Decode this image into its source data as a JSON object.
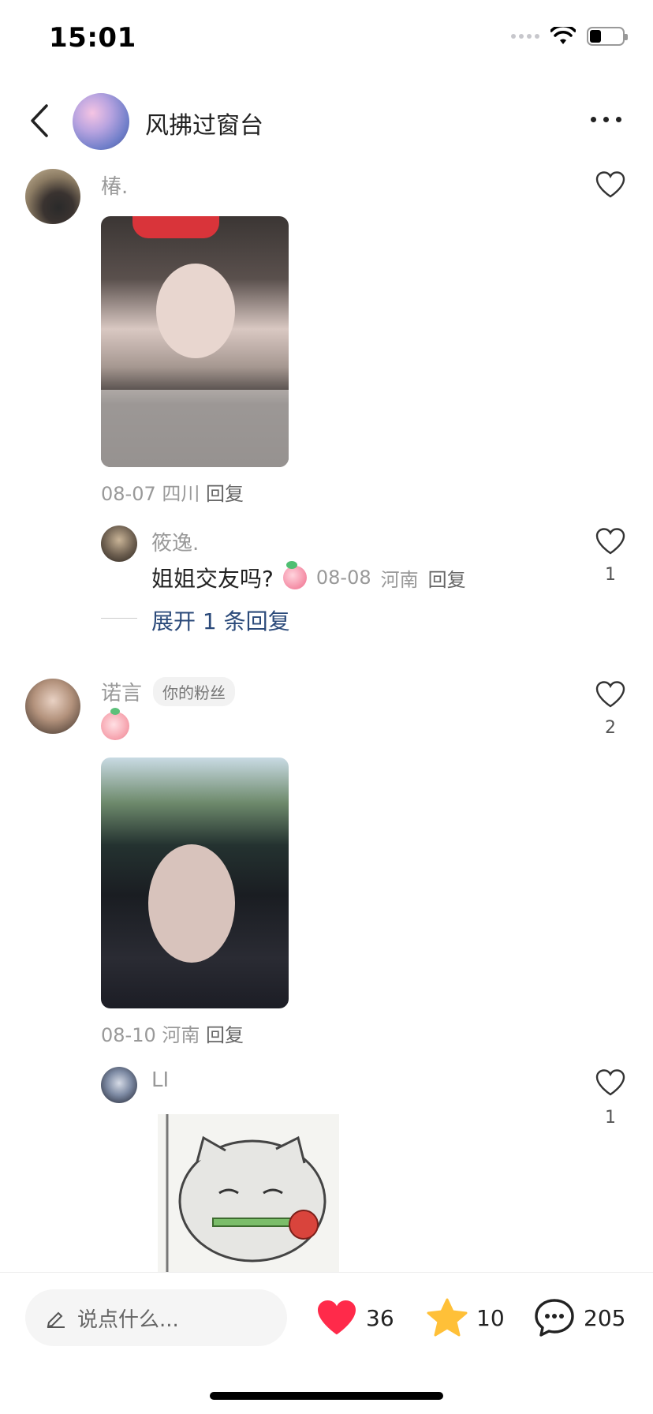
{
  "status_bar": {
    "time": "15:01"
  },
  "header": {
    "title": "风拂过窗台"
  },
  "comments": [
    {
      "name": "椿.",
      "meta_date": "08-07",
      "meta_location": "四川",
      "reply_label": "回复",
      "replies": [
        {
          "name": "筱逸.",
          "text": "姐姐交友吗?",
          "meta_date": "08-08",
          "meta_location": "河南",
          "reply_label": "回复",
          "likes": "1"
        }
      ],
      "expand_label": "展开 1 条回复"
    },
    {
      "name": "诺言",
      "badge": "你的粉丝",
      "likes": "2",
      "meta_date": "08-10",
      "meta_location": "河南",
      "reply_label": "回复",
      "replies": [
        {
          "name": "LI",
          "likes": "1"
        }
      ]
    }
  ],
  "bottom_bar": {
    "input_placeholder": "说点什么...",
    "likes": "36",
    "favorites": "10",
    "comments": "205"
  },
  "colors": {
    "heart": "#ff2a4a",
    "star": "#ffc038",
    "link": "#2b4a7a"
  }
}
